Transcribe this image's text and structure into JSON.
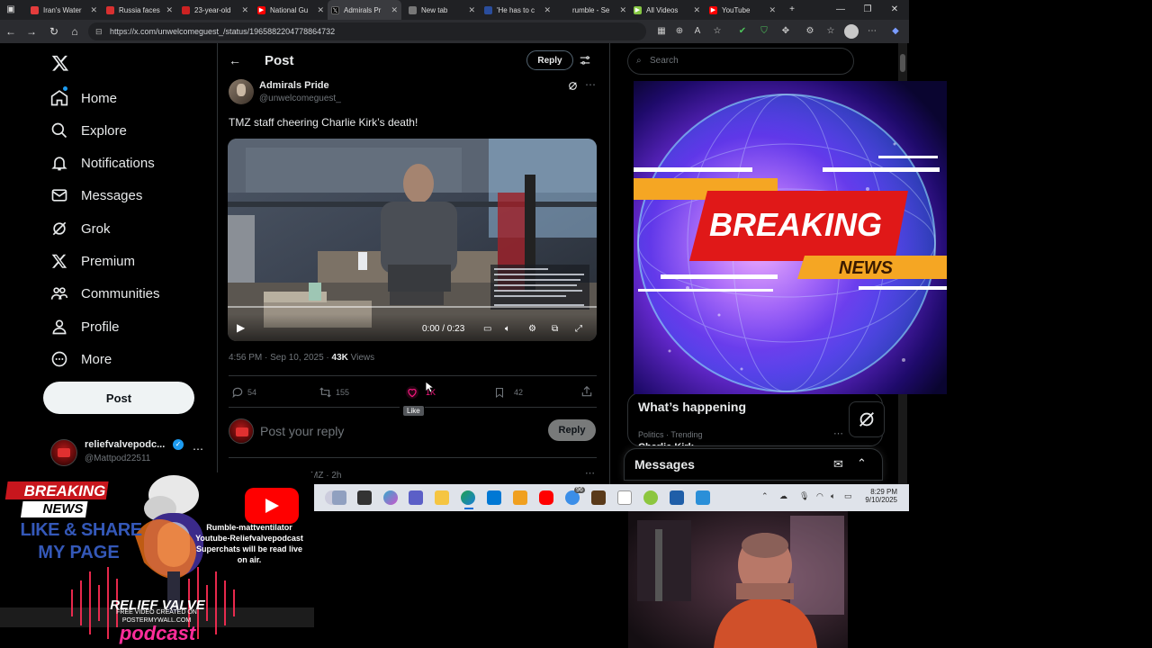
{
  "browser": {
    "tabs": [
      {
        "label": "Iran's Water",
        "color": "#e43c3c"
      },
      {
        "label": "Russia faces",
        "color": "#d83030"
      },
      {
        "label": "23-year-old",
        "color": "#cc2222"
      },
      {
        "label": "National Gu",
        "color": "#ff0000"
      },
      {
        "label": "Admirals Pr",
        "color": "#000000"
      },
      {
        "label": "New tab",
        "color": "#888888"
      },
      {
        "label": "'He has to c",
        "color": "#2a4d9c"
      },
      {
        "label": "rumble - Se",
        "color": "#4aa33a"
      },
      {
        "label": "All Videos",
        "color": "#85c742"
      },
      {
        "label": "YouTube",
        "color": "#ff0000"
      }
    ],
    "active_tab_index": 4,
    "url": "https://x.com/unwelcomeguest_/status/1965882204778864732"
  },
  "x": {
    "nav": [
      {
        "label": "Home",
        "icon": "home-icon"
      },
      {
        "label": "Explore",
        "icon": "search-icon"
      },
      {
        "label": "Notifications",
        "icon": "bell-icon"
      },
      {
        "label": "Messages",
        "icon": "mail-icon"
      },
      {
        "label": "Grok",
        "icon": "grok-icon"
      },
      {
        "label": "Premium",
        "icon": "x-logo-icon"
      },
      {
        "label": "Communities",
        "icon": "people-icon"
      },
      {
        "label": "Profile",
        "icon": "person-icon"
      },
      {
        "label": "More",
        "icon": "more-circle-icon"
      }
    ],
    "post_button": "Post",
    "account": {
      "name": "reliefvalvepodc...",
      "handle": "@Mattpod22511"
    },
    "header": {
      "title": "Post",
      "reply_button": "Reply"
    },
    "tweet": {
      "author_name": "Admirals Pride",
      "author_handle": "@unwelcomeguest_",
      "text": "TMZ staff cheering Charlie Kirk’s death!",
      "video_time": "0:00 / 0:23",
      "timestamp": "4:56 PM · Sep 10, 2025 · ",
      "views_count": "43K",
      "views_label": " Views",
      "replies": "54",
      "reposts": "155",
      "likes": "1K",
      "bookmarks": "42",
      "like_tooltip": "Like"
    },
    "reply_box": {
      "placeholder": "Post your reply",
      "button": "Reply"
    },
    "next_tweet_meta": "MZ · 2h",
    "search_placeholder": "Search",
    "whats_happening": {
      "title": "What’s happening",
      "trend_meta": "Politics · Trending",
      "trend_name": "Charlie Kirk"
    },
    "messages_title": "Messages"
  },
  "breaking_graphic": {
    "line1": "BREAKING",
    "line2": "NEWS"
  },
  "taskbar": {
    "time": "8:29 PM",
    "date": "9/10/2025",
    "badge": "96"
  },
  "overlay": {
    "breaking": "BREAKING",
    "news": "NEWS",
    "like_share": "LIKE & SHARE",
    "my_page": "MY PAGE",
    "rumble_line": "Rumble-mattventilator",
    "youtube_line": "Youtube-Reliefvalvepodcast",
    "superchat_line": "Superchats will be read live",
    "on_air": "on air.",
    "relief_valve": "RELIEF VALVE",
    "podcast": "podcast",
    "free_video_line1": "FREE VIDEO CREATED ON",
    "free_video_line2": "POSTERMYWALL.COM"
  },
  "colors": {
    "accent": "#1d9bf0",
    "like": "#f91880",
    "bg": "#000000",
    "text": "#e7e9ea",
    "muted": "#71767b"
  }
}
